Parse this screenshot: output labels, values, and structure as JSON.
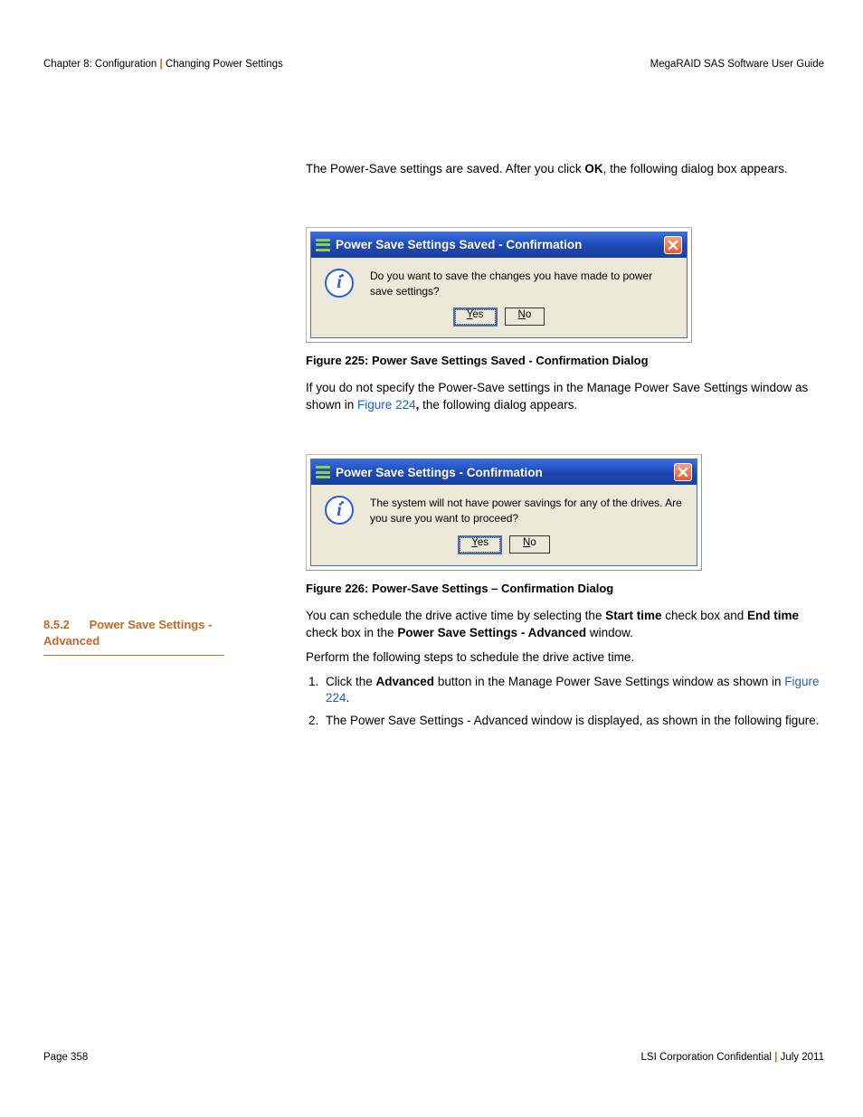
{
  "header": {
    "chapter": "Chapter 8: Configuration",
    "section": "Changing Power Settings",
    "doc_title": "MegaRAID SAS Software User Guide"
  },
  "content": {
    "intro_pre": "The Power-Save settings are saved. After you click ",
    "intro_bold": "OK",
    "intro_post": ", the following dialog box appears.",
    "figure225": "Figure 225:    Power Save Settings Saved - Confirmation Dialog",
    "para2_pre": "If you do not specify the Power-Save settings in the Manage Power Save Settings window as shown in ",
    "para2_link": "Figure 224",
    "para2_bold": ",",
    "para2_post": " the following dialog appears.",
    "figure226": "Figure 226:    Power-Save Settings – Confirmation Dialog",
    "para3_pre": "You can schedule the drive active time by selecting the ",
    "para3_b1": "Start time",
    "para3_mid1": " check box and ",
    "para3_b2": "End time",
    "para3_mid2": " check box in the ",
    "para3_b3": "Power Save Settings - Advanced",
    "para3_post": " window.",
    "para4": "Perform the following steps to schedule the drive active time.",
    "step1_pre": "Click the ",
    "step1_bold": "Advanced",
    "step1_mid": " button in the Manage Power Save Settings window as shown in ",
    "step1_link": "Figure 224",
    "step1_post": ".",
    "step2": "The Power Save Settings - Advanced window is displayed, as shown in the following figure."
  },
  "dialog1": {
    "title": "Power Save Settings Saved - Confirmation",
    "message": "Do you want to save the changes you have made to power save settings?",
    "yes_prefix": "Y",
    "yes_rest": "es",
    "no_prefix": "N",
    "no_rest": "o"
  },
  "dialog2": {
    "title": "Power Save Settings - Confirmation",
    "message": "The system will not have power savings for any of the drives. Are you sure you want to proceed?",
    "yes_prefix": "Y",
    "yes_rest": "es",
    "no_prefix": "N",
    "no_rest": "o"
  },
  "sidebar": {
    "section_num": "8.5.2",
    "section_title": "Power Save Settings - Advanced"
  },
  "footer": {
    "page": "Page 358",
    "conf": "LSI Corporation Confidential",
    "date": "July 2011"
  }
}
